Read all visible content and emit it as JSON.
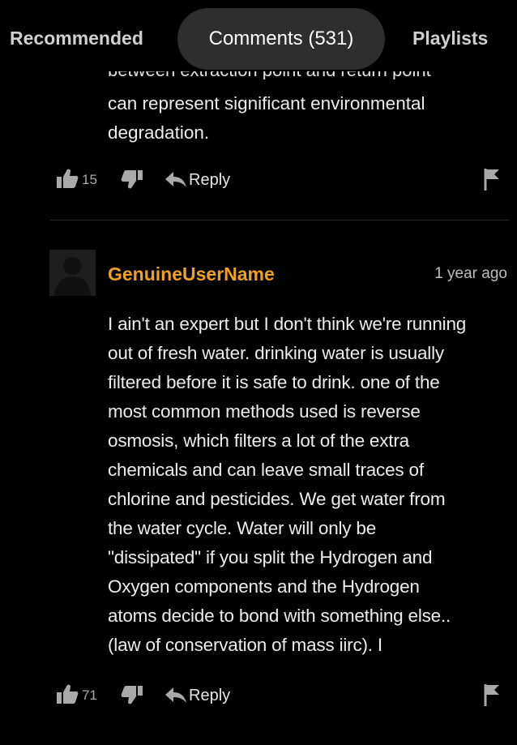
{
  "tabs": {
    "recommended": "Recommended",
    "comments": "Comments (531)",
    "playlists": "Playlists"
  },
  "comments": [
    {
      "partial_top_line": "between extraction point and return point",
      "text": "can represent significant environmental\ndegradation.",
      "likes": "15",
      "reply_label": "Reply"
    },
    {
      "username": "GenuineUserName",
      "timestamp": "1 year ago",
      "text": "I ain't an expert but I don't think we're running\nout of fresh water. drinking water is usually\nfiltered before it is safe to drink. one of the\nmost common methods used is reverse\nosmosis, which filters a lot of the extra\nchemicals and can leave small traces of\nchlorine and pesticides. We get water from\nthe water cycle. Water will only be\n\"dissipated\" if you split the Hydrogen and\nOxygen components and the Hydrogen\natoms decide to bond with something else..\n(law of conservation of mass iirc). I",
      "likes": "71",
      "reply_label": "Reply"
    }
  ],
  "colors": {
    "background": "#000000",
    "username": "#f0a21e",
    "active_tab_pill": "#2e2e2e",
    "icon": "#a9a9a9"
  },
  "icons": [
    "thumbs-up-icon",
    "thumbs-down-icon",
    "reply-arrow-icon",
    "flag-icon",
    "avatar-icon"
  ]
}
